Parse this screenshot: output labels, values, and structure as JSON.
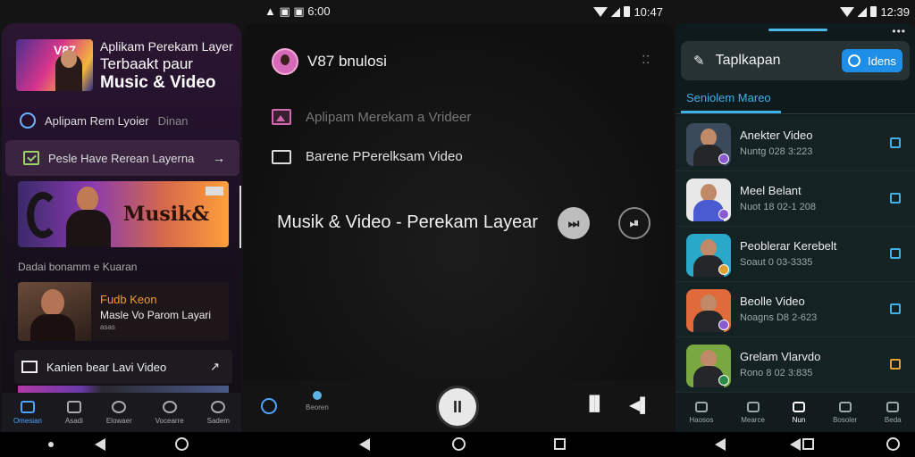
{
  "status_mid": {
    "left": "▲ ▣ ▣ 6:00",
    "time": "10:47"
  },
  "status_right": {
    "time": "12:39"
  },
  "left_panel": {
    "hero_badge": "V87",
    "hero_line1": "Aplikam Perekam Layer",
    "hero_line2": "Terbaakt paur",
    "hero_line3": "Music & Video",
    "row1_label": "Aplipam Rem Lyoier",
    "row1_sub": "Dinan",
    "row2_label": "Pesle Have Rerean Layerna",
    "row2_arrow": "→",
    "banner_text": "Musik&",
    "section_label": "Dadai bonamm e Kuaran",
    "card_title": "Fudb Keon",
    "card_sub": "Masle Vo Parom Layari",
    "card_tiny": "asas",
    "row3_label": "Kanien bear Lavi Video",
    "row3_arrow": "↗",
    "nav": [
      {
        "label": "Omesian",
        "icon": "home-icon"
      },
      {
        "label": "Asadi",
        "icon": "square-icon"
      },
      {
        "label": "Elowaer",
        "icon": "search-icon"
      },
      {
        "label": "Vocearre",
        "icon": "record-icon"
      },
      {
        "label": "Sadem",
        "icon": "search-alt-icon"
      }
    ]
  },
  "mid_panel": {
    "title": "V87 bnulosi",
    "menu_dots": "⁚⁚",
    "row1_label": "Aplipam Merekam a Vrideer",
    "row2_label": "Barene PPerelksam Video",
    "track_title": "Musik & Video - Perekam Layear",
    "btn_a": "⏭",
    "btn_b": "⏯",
    "nav_label": "Beoren",
    "pause": "II",
    "r1": "▐▌",
    "r2": "◀▌"
  },
  "right_panel": {
    "header_title": "Taplkapan",
    "header_btn": "Idens",
    "tab": "Seniolem Mareo",
    "items": [
      {
        "title": "Anekter Video",
        "sub": "Nuntg 028 3:223",
        "thumb": "#3a4a5a"
      },
      {
        "title": "Meel Belant",
        "sub": "Nuot 18 02-1 208",
        "thumb": "#e8e8e8"
      },
      {
        "title": "Peoblerar Kerebelt",
        "sub": "Soaut 0 03-3335",
        "thumb": "#2aa8c8"
      },
      {
        "title": "Beolle Video",
        "sub": "Noagns D8 2-623",
        "thumb": "#e06a3a"
      },
      {
        "title": "Grelam Vlarvdo",
        "sub": "Rono 8 02 3:835",
        "thumb": "#7aa840"
      }
    ],
    "nav": [
      {
        "label": "Haosos",
        "icon": "wings-icon"
      },
      {
        "label": "Mearce",
        "icon": "search-icon"
      },
      {
        "label": "Nun",
        "icon": "home-icon"
      },
      {
        "label": "Bosoler",
        "icon": "camera-icon"
      },
      {
        "label": "Beda",
        "icon": "grid-icon"
      }
    ]
  }
}
